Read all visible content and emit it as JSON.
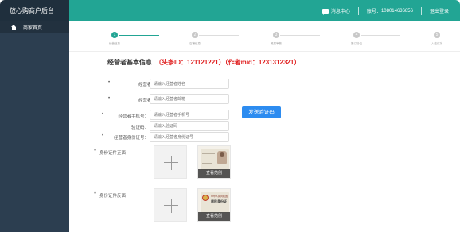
{
  "header": {
    "app_title": "放心购商户后台",
    "message_center": "消息中心",
    "account_label": "账号：",
    "account_value": "108014636856",
    "logout": "退出登录",
    "colors": {
      "brand_bg": "#1f2f3d",
      "topbar_bg": "#22a594"
    }
  },
  "sidebar": {
    "items": [
      {
        "label": "商家首页",
        "icon": "home-icon"
      }
    ]
  },
  "steps": {
    "items": [
      {
        "num": "1",
        "label": "经营信息",
        "active": true
      },
      {
        "num": "2",
        "label": "店铺信息",
        "active": false
      },
      {
        "num": "3",
        "label": "资质审核",
        "active": false
      },
      {
        "num": "4",
        "label": "签订协议",
        "active": false
      },
      {
        "num": "5",
        "label": "入驻成功",
        "active": false
      }
    ]
  },
  "form": {
    "title": "经营者基本信息",
    "ids": "（头条ID：121121221）（作者mid：1231312321）",
    "fields": [
      {
        "label": "经营者姓名：",
        "placeholder": "请输入经营者姓名"
      },
      {
        "label": "经营者邮箱：",
        "placeholder": "请输入经营者邮箱"
      },
      {
        "label": "经营者手机号：",
        "placeholder": "请输入经营者手机号"
      },
      {
        "label": "验证码：",
        "placeholder": "请输入验证码"
      },
      {
        "label": "经营者身份证号：",
        "placeholder": "请输入经营者身份证号"
      }
    ],
    "send_code": "发送验证码",
    "id_front_label": "身份证件正面",
    "id_back_label": "身份证件反面",
    "sample_label": "查看范例",
    "sample_back_title": "中华人民共和国",
    "sample_back_subtitle": "居民身份证",
    "accent": "#2d8cf0",
    "required_color": "#e02020"
  }
}
